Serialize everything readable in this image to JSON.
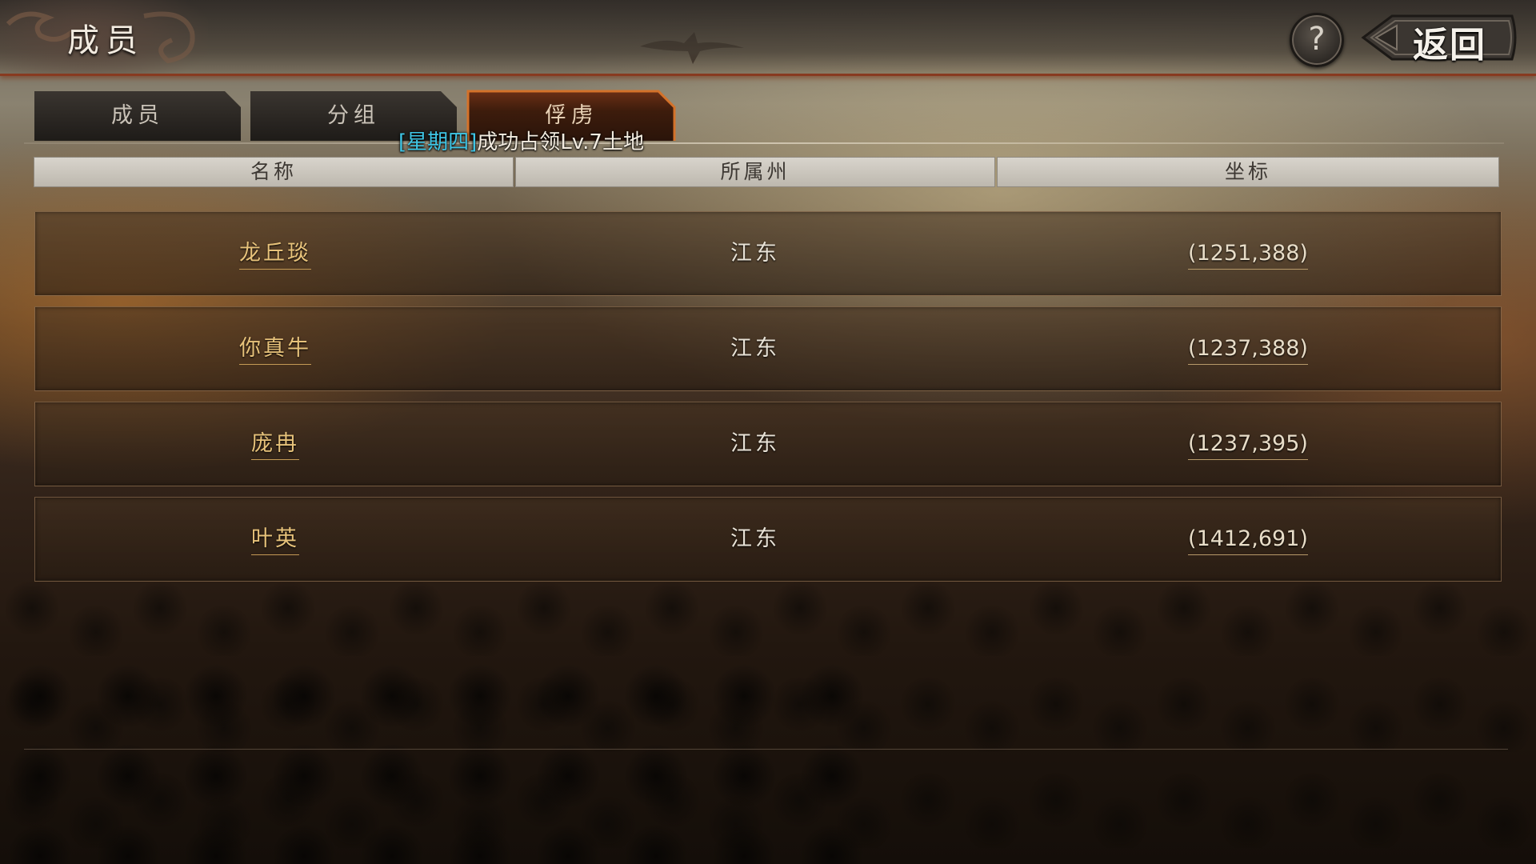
{
  "header": {
    "title": "成员",
    "help_label": "?",
    "back_label": "返回"
  },
  "tabs": [
    {
      "label": "成员",
      "active": false
    },
    {
      "label": "分组",
      "active": false
    },
    {
      "label": "俘虏",
      "active": true
    }
  ],
  "notice": {
    "tag": "[星期四]",
    "text": "成功占领Lv.7土地"
  },
  "table": {
    "columns": [
      "名称",
      "所属州",
      "坐标"
    ],
    "rows": [
      {
        "name": "龙丘琰",
        "state": "江东",
        "coord": "(1251,388)"
      },
      {
        "name": "你真牛",
        "state": "江东",
        "coord": "(1237,388)"
      },
      {
        "name": "庞冉",
        "state": "江东",
        "coord": "(1237,395)"
      },
      {
        "name": "叶英",
        "state": "江东",
        "coord": "(1412,691)"
      }
    ]
  },
  "colors": {
    "accent_gold": "#e7c27a",
    "notice_tag": "#3fc6e6",
    "active_tab": "#6b2f15"
  }
}
